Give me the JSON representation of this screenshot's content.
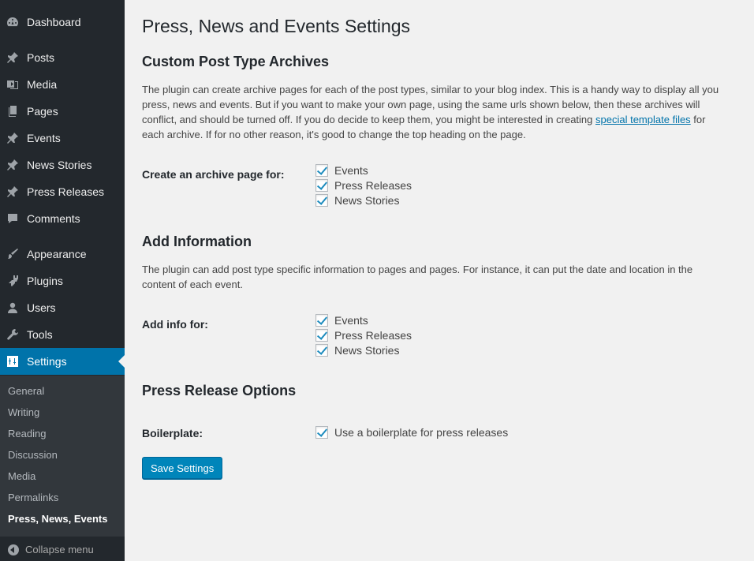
{
  "sidebar": {
    "items": [
      {
        "label": "Dashboard",
        "icon": "dashboard-icon"
      },
      {
        "label": "Posts",
        "icon": "pin-icon"
      },
      {
        "label": "Media",
        "icon": "media-icon"
      },
      {
        "label": "Pages",
        "icon": "pages-icon"
      },
      {
        "label": "Events",
        "icon": "pin-icon"
      },
      {
        "label": "News Stories",
        "icon": "pin-icon"
      },
      {
        "label": "Press Releases",
        "icon": "pin-icon"
      },
      {
        "label": "Comments",
        "icon": "comment-icon"
      },
      {
        "label": "Appearance",
        "icon": "brush-icon"
      },
      {
        "label": "Plugins",
        "icon": "plugin-icon"
      },
      {
        "label": "Users",
        "icon": "user-icon"
      },
      {
        "label": "Tools",
        "icon": "wrench-icon"
      },
      {
        "label": "Settings",
        "icon": "settings-icon"
      }
    ],
    "submenu": [
      "General",
      "Writing",
      "Reading",
      "Discussion",
      "Media",
      "Permalinks",
      "Press, News, Events"
    ],
    "collapse_label": "Collapse menu"
  },
  "page": {
    "title": "Press, News and Events Settings"
  },
  "archives": {
    "heading": "Custom Post Type Archives",
    "description_before": "The plugin can create archive pages for each of the post types, similar to your blog index. This is a handy way to display all you press, news and events. But if you want to make your own page, using the same urls shown below, then these archives will conflict, and should be turned off. If you do decide to keep them, you might be interested in creating ",
    "link_text": "special template files",
    "description_after": " for each archive. If for no other reason, it's good to change the top heading on the page.",
    "field_label": "Create an archive page for:",
    "options": [
      {
        "label": "Events",
        "checked": true
      },
      {
        "label": "Press Releases",
        "checked": true
      },
      {
        "label": "News Stories",
        "checked": true
      }
    ]
  },
  "info": {
    "heading": "Add Information",
    "description": "The plugin can add post type specific information to pages and pages. For instance, it can put the date and location in the content of each event.",
    "field_label": "Add info for:",
    "options": [
      {
        "label": "Events",
        "checked": true
      },
      {
        "label": "Press Releases",
        "checked": true
      },
      {
        "label": "News Stories",
        "checked": true
      }
    ]
  },
  "press_release": {
    "heading": "Press Release Options",
    "field_label": "Boilerplate:",
    "option_label": "Use a boilerplate for press releases",
    "option_checked": true
  },
  "save_label": "Save Settings",
  "colors": {
    "sidebar_bg": "#23282d",
    "submenu_bg": "#32373c",
    "accent": "#0073aa",
    "button": "#0085ba"
  }
}
